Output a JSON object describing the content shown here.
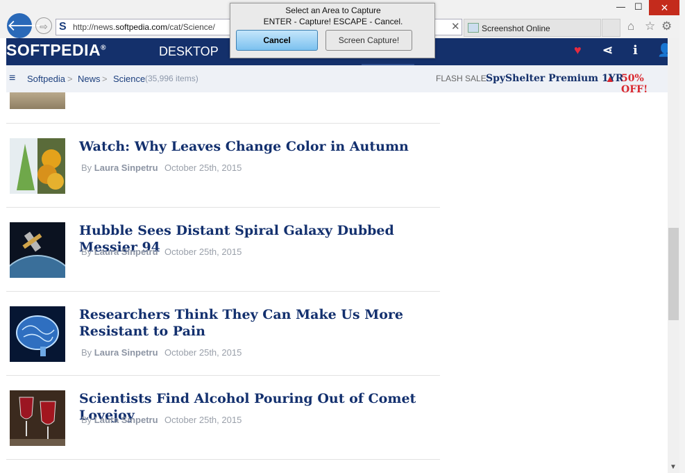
{
  "browser": {
    "url_prefix": "http://news.",
    "url_domain": "softpedia.com",
    "url_path": "/cat/Science/",
    "site_favicon": "S",
    "tab_arrows": "◂ ▸",
    "tab_close": "✕",
    "tab2_title": "Screenshot Online",
    "back_icon": "🡐",
    "forward_icon": "⇨",
    "minimize": "—",
    "maximize": "☐",
    "close": "✕",
    "home_icon": "⌂",
    "star_icon": "☆",
    "gear_icon": "⚙"
  },
  "capture_dialog": {
    "line1": "Select an Area to Capture",
    "line2": "ENTER - Capture! ESCAPE - Cancel.",
    "cancel_label": "Cancel",
    "capture_label": "Screen Capture!"
  },
  "site": {
    "logo": "SOFTPEDIA",
    "logo_mark": "®",
    "section": "DESKTOP",
    "header_icons": {
      "heart": "♥",
      "share": "⋖",
      "info": "i",
      "user": "👤"
    }
  },
  "breadcrumb": {
    "menu_icon": "≡",
    "items": [
      "Softpedia",
      "News",
      "Science"
    ],
    "separator": ">",
    "count": "(35,996 items)",
    "flash_label": "FLASH SALE:",
    "flash_product": "SpyShelter Premium 1YR",
    "warning_icon": "▲",
    "flash_offer": "50% OFF!"
  },
  "articles": [
    {
      "title": "Watch: Why Leaves Change Color in Autumn",
      "by": "By",
      "author": "Laura Sinpetru",
      "date": "October 25th, 2015"
    },
    {
      "title": "Hubble Sees Distant Spiral Galaxy Dubbed Messier 94",
      "by": "By",
      "author": "Laura Sinpetru",
      "date": "October 25th, 2015"
    },
    {
      "title": "Researchers Think They Can Make Us More Resistant to Pain",
      "by": "By",
      "author": "Laura Sinpetru",
      "date": "October 25th, 2015"
    },
    {
      "title": "Scientists Find Alcohol Pouring Out of Comet Lovejoy",
      "by": "By",
      "author": "Laura Sinpetru",
      "date": "October 25th, 2015"
    }
  ],
  "colors": {
    "brand_navy": "#14306b",
    "headline": "#13306e",
    "accent_red": "#d9272e"
  }
}
